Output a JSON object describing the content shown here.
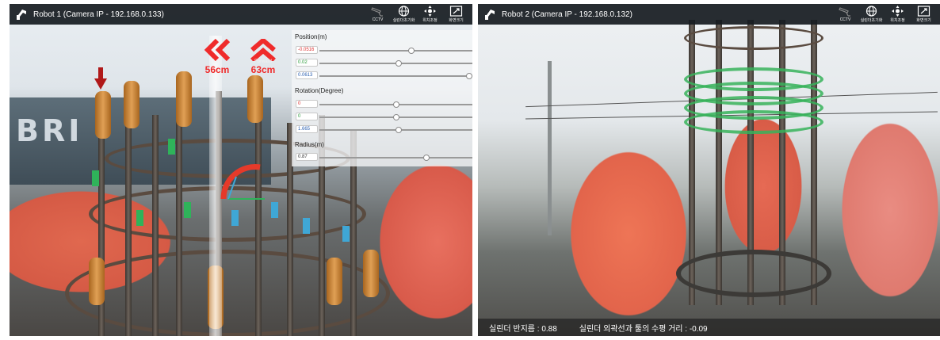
{
  "left": {
    "title": "Robot 1 (Camera IP - 192.168.0.133)",
    "tools": [
      {
        "label": "CCTV",
        "icon": "cctv-camera-icon"
      },
      {
        "label": "실린더초기화",
        "icon": "globe-grid-icon"
      },
      {
        "label": "위치조정",
        "icon": "position-adjust-icon"
      },
      {
        "label": "화면크기",
        "icon": "resize-window-icon"
      }
    ],
    "overlay": {
      "hint_left": {
        "small": "Left",
        "big": "56cm"
      },
      "hint_forward": {
        "small": "Forward",
        "big": "63cm"
      },
      "brand_text": "BRI",
      "position": {
        "heading": "Position(m)",
        "x": {
          "value": "-0.0516",
          "level": 0.6
        },
        "y": {
          "value": "0.02",
          "level": 0.52
        },
        "z": {
          "value": "0.0613",
          "level": 0.98
        }
      },
      "rotation": {
        "heading": "Rotation(Degree)",
        "x": {
          "value": "0",
          "level": 0.5
        },
        "y": {
          "value": "0",
          "level": 0.5
        },
        "z": {
          "value": "1.665",
          "level": 0.52
        }
      },
      "radius": {
        "heading": "Radius(m)",
        "value": {
          "value": "0.87",
          "level": 0.7
        }
      }
    }
  },
  "right": {
    "title": "Robot 2 (Camera IP - 192.168.0.132)",
    "tools": [
      {
        "label": "CCTV",
        "icon": "cctv-camera-icon"
      },
      {
        "label": "실린더초기화",
        "icon": "globe-grid-icon"
      },
      {
        "label": "위치조정",
        "icon": "position-adjust-icon"
      },
      {
        "label": "화면크기",
        "icon": "resize-window-icon"
      }
    ],
    "status": {
      "radius_text": "실린더 반지름 : 0.88",
      "distance_text": "실린더 외곽선과 툴의 수평 거리 : -0.09"
    }
  },
  "colors": {
    "titlebar": "#161b21",
    "hint_red": "#ef2b2b",
    "robot_orange": "#e2644b",
    "ar_green": "#2fb35a",
    "ar_cyan": "#3fa7d6"
  }
}
